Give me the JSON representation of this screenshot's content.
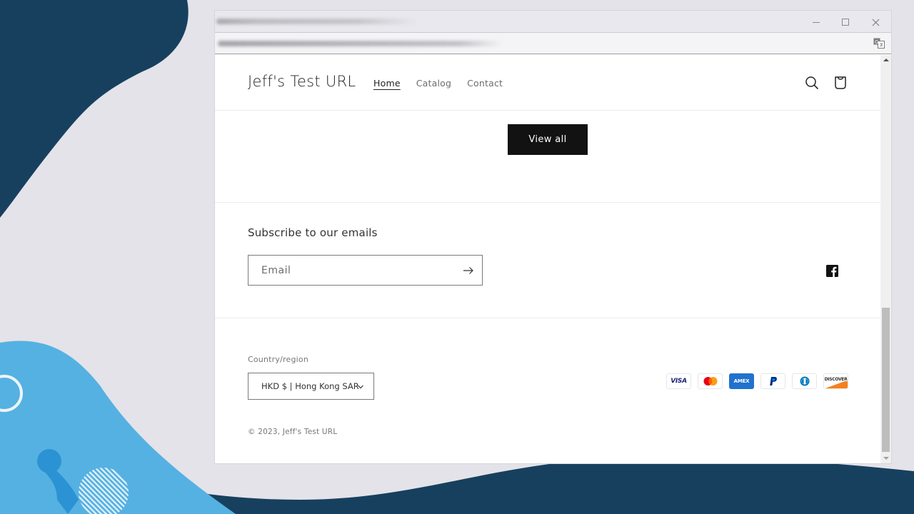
{
  "background": {
    "colors": {
      "base": "#e4e3e9",
      "navy": "#17405f",
      "light_blue": "#55b1e2",
      "mid_blue": "#2b93d3"
    }
  },
  "window": {
    "title_obscured": true,
    "url_obscured": true,
    "controls": {
      "minimize": "minimize",
      "maximize": "maximize",
      "close": "close"
    }
  },
  "site": {
    "logo": "Jeff's Test URL",
    "nav": [
      {
        "label": "Home",
        "active": true
      },
      {
        "label": "Catalog",
        "active": false
      },
      {
        "label": "Contact",
        "active": false
      }
    ],
    "header_icons": [
      "search-icon",
      "cart-icon"
    ],
    "view_all_label": "View all",
    "newsletter": {
      "title": "Subscribe to our emails",
      "email_placeholder": "Email",
      "email_value": ""
    },
    "social": [
      "facebook-icon"
    ],
    "country": {
      "label": "Country/region",
      "selected": "HKD $ | Hong Kong SAR"
    },
    "payments": [
      "Visa",
      "Mastercard",
      "American Express",
      "PayPal",
      "Diners Club",
      "Discover"
    ],
    "payment_labels": {
      "visa": "VISA",
      "amex": "AMEX",
      "discover": "DISCOVER"
    },
    "copyright": "© 2023, Jeff's Test URL"
  },
  "scrollbar": {
    "position_fraction": 0.98
  }
}
